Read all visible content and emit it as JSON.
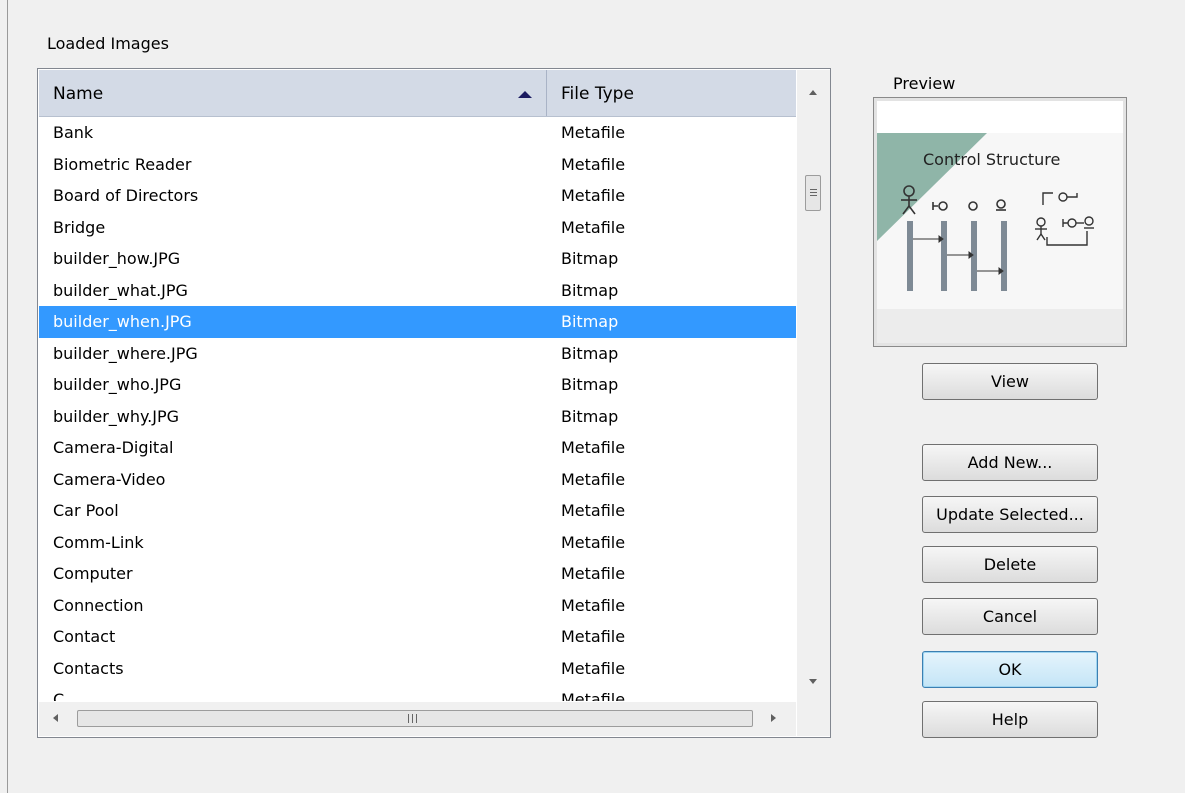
{
  "group_label": "Loaded Images",
  "list": {
    "columns": [
      {
        "label": "Name",
        "sort": "ascending"
      },
      {
        "label": "File Type"
      }
    ],
    "rows": [
      {
        "name": "Bank",
        "type": "Metafile"
      },
      {
        "name": "Biometric Reader",
        "type": "Metafile"
      },
      {
        "name": "Board of Directors",
        "type": "Metafile"
      },
      {
        "name": "Bridge",
        "type": "Metafile"
      },
      {
        "name": "builder_how.JPG",
        "type": "Bitmap"
      },
      {
        "name": "builder_what.JPG",
        "type": "Bitmap"
      },
      {
        "name": "builder_when.JPG",
        "type": "Bitmap",
        "selected": true
      },
      {
        "name": "builder_where.JPG",
        "type": "Bitmap"
      },
      {
        "name": "builder_who.JPG",
        "type": "Bitmap"
      },
      {
        "name": "builder_why.JPG",
        "type": "Bitmap"
      },
      {
        "name": "Camera-Digital",
        "type": "Metafile"
      },
      {
        "name": "Camera-Video",
        "type": "Metafile"
      },
      {
        "name": "Car Pool",
        "type": "Metafile"
      },
      {
        "name": "Comm-Link",
        "type": "Metafile"
      },
      {
        "name": "Computer",
        "type": "Metafile"
      },
      {
        "name": "Connection",
        "type": "Metafile"
      },
      {
        "name": "Contact",
        "type": "Metafile"
      },
      {
        "name": "Contacts",
        "type": "Metafile"
      },
      {
        "name": "C...",
        "type": "Metafile"
      }
    ]
  },
  "preview": {
    "label": "Preview",
    "image_title": "Control Structure"
  },
  "buttons": {
    "view": "View",
    "add_new": "Add New...",
    "update_selected": "Update Selected...",
    "delete": "Delete",
    "cancel": "Cancel",
    "ok": "OK",
    "help": "Help"
  },
  "colors": {
    "selection": "#3399ff",
    "header_bg": "#d3dae6",
    "preview_accent": "#8fb5a8"
  }
}
